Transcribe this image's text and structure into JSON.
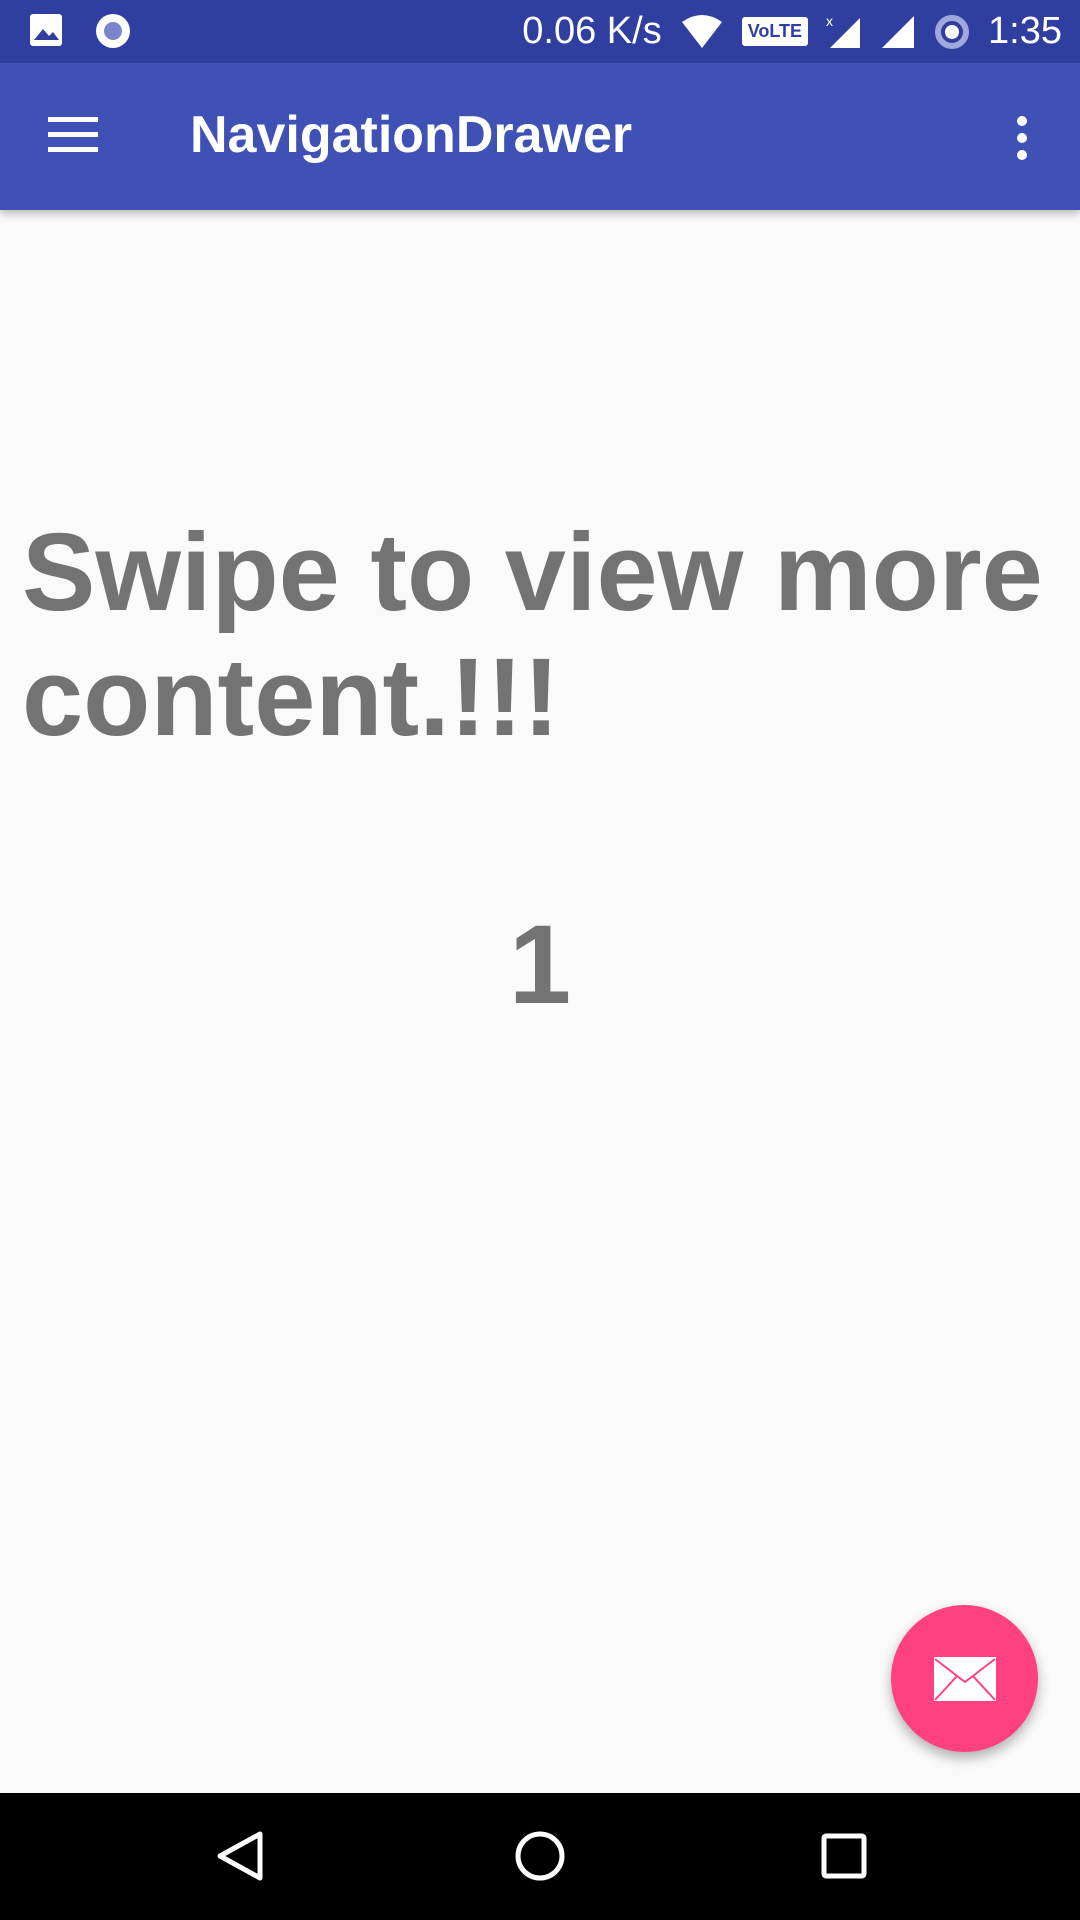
{
  "status_bar": {
    "net_speed": "0.06 K/s",
    "volte": "VoLTE",
    "time": "1:35",
    "icons": [
      "image-icon",
      "record-icon",
      "wifi-icon",
      "volte-icon",
      "signal-roaming-icon",
      "signal-icon",
      "data-saver-icon"
    ]
  },
  "app_bar": {
    "title": "NavigationDrawer",
    "icons": [
      "menu-icon",
      "more-vert-icon"
    ]
  },
  "content": {
    "message": "Swipe to view more content.!!!",
    "page_number": "1"
  },
  "fab": {
    "icon": "mail-icon",
    "color": "#ff4081"
  },
  "colors": {
    "primary": "#3f51b5",
    "primary_dark": "#303f9f",
    "text": "#737373"
  }
}
